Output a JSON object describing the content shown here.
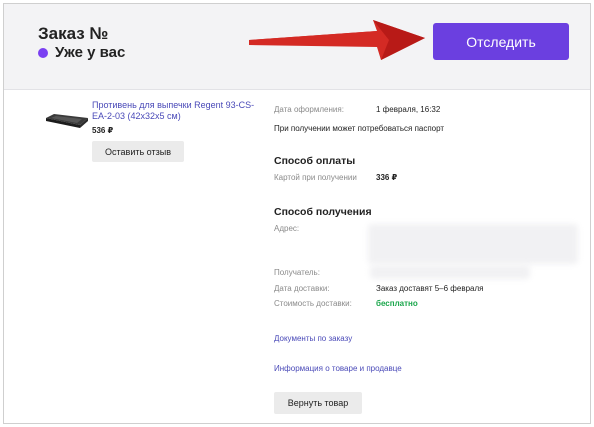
{
  "header": {
    "title": "Заказ №",
    "status": "Уже у вас",
    "status_color": "#7a3ff2",
    "track_button": "Отследить",
    "track_button_color": "#6b3fe0"
  },
  "product": {
    "name": "Противень для выпечки Regent 93-CS-EA-2-03 (42x32x5 см)",
    "price": "536 ₽",
    "review_button": "Оставить отзыв"
  },
  "details": {
    "order_date_label": "Дата оформления:",
    "order_date_value": "1 февраля, 16:32",
    "passport_note": "При получении может потребоваться паспорт",
    "payment": {
      "title": "Способ оплаты",
      "method_label": "Картой при получении",
      "amount": "336 ₽"
    },
    "delivery": {
      "title": "Способ получения",
      "address_label": "Адрес:",
      "recipient_label": "Получатель:",
      "date_label": "Дата доставки:",
      "date_value": "Заказ доставят 5–6 февраля",
      "cost_label": "Стоимость доставки:",
      "cost_value": "бесплатно",
      "cost_color": "#1aa64b"
    },
    "documents_link": "Документы по заказу",
    "info_link": "Информация о товаре и продавце",
    "return_button": "Вернуть товар"
  }
}
